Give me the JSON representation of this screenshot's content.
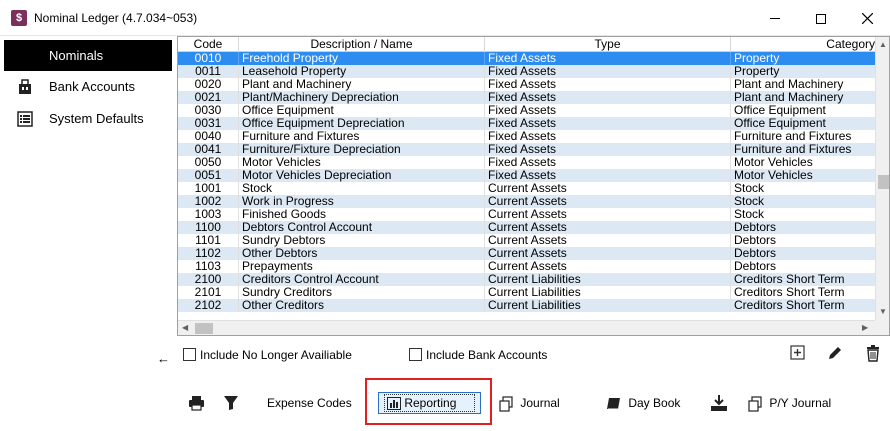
{
  "window": {
    "title": "Nominal Ledger (4.7.034~053)",
    "app_icon_glyph": "$"
  },
  "sidebar": {
    "items": [
      {
        "label": "Nominals",
        "icon": "list-icon",
        "active": true
      },
      {
        "label": "Bank Accounts",
        "icon": "bank-icon",
        "active": false
      },
      {
        "label": "System Defaults",
        "icon": "defaults-list-icon",
        "active": false
      }
    ]
  },
  "grid": {
    "columns": [
      "Code",
      "Description / Name",
      "Type",
      "Category"
    ],
    "rows": [
      {
        "code": "0010",
        "desc": "Freehold Property",
        "type": "Fixed Assets",
        "cat": "Property",
        "selected": true
      },
      {
        "code": "0011",
        "desc": "Leasehold Property",
        "type": "Fixed Assets",
        "cat": "Property"
      },
      {
        "code": "0020",
        "desc": "Plant and Machinery",
        "type": "Fixed Assets",
        "cat": "Plant and Machinery"
      },
      {
        "code": "0021",
        "desc": "Plant/Machinery Depreciation",
        "type": "Fixed Assets",
        "cat": "Plant and Machinery"
      },
      {
        "code": "0030",
        "desc": "Office Equipment",
        "type": "Fixed Assets",
        "cat": "Office Equipment"
      },
      {
        "code": "0031",
        "desc": "Office Equipment Depreciation",
        "type": "Fixed Assets",
        "cat": "Office Equipment"
      },
      {
        "code": "0040",
        "desc": "Furniture and Fixtures",
        "type": "Fixed Assets",
        "cat": "Furniture and Fixtures"
      },
      {
        "code": "0041",
        "desc": "Furniture/Fixture Depreciation",
        "type": "Fixed Assets",
        "cat": "Furniture and Fixtures"
      },
      {
        "code": "0050",
        "desc": "Motor Vehicles",
        "type": "Fixed Assets",
        "cat": "Motor Vehicles"
      },
      {
        "code": "0051",
        "desc": "Motor Vehicles Depreciation",
        "type": "Fixed Assets",
        "cat": "Motor Vehicles"
      },
      {
        "code": "1001",
        "desc": "Stock",
        "type": "Current Assets",
        "cat": "Stock"
      },
      {
        "code": "1002",
        "desc": "Work in Progress",
        "type": "Current Assets",
        "cat": "Stock"
      },
      {
        "code": "1003",
        "desc": "Finished Goods",
        "type": "Current Assets",
        "cat": "Stock"
      },
      {
        "code": "1100",
        "desc": "Debtors Control Account",
        "type": "Current Assets",
        "cat": "Debtors"
      },
      {
        "code": "1101",
        "desc": "Sundry Debtors",
        "type": "Current Assets",
        "cat": "Debtors"
      },
      {
        "code": "1102",
        "desc": "Other Debtors",
        "type": "Current Assets",
        "cat": "Debtors"
      },
      {
        "code": "1103",
        "desc": "Prepayments",
        "type": "Current Assets",
        "cat": "Debtors"
      },
      {
        "code": "2100",
        "desc": "Creditors Control Account",
        "type": "Current Liabilities",
        "cat": "Creditors Short Term"
      },
      {
        "code": "2101",
        "desc": "Sundry Creditors",
        "type": "Current Liabilities",
        "cat": "Creditors Short Term"
      },
      {
        "code": "2102",
        "desc": "Other Creditors",
        "type": "Current Liabilities",
        "cat": "Creditors Short Term"
      }
    ]
  },
  "options": {
    "include_no_longer_available": "Include No Longer Availiable",
    "include_bank_accounts": "Include Bank Accounts"
  },
  "toolbar": {
    "expense_codes": "Expense Codes",
    "reporting": "Reporting",
    "journal": "Journal",
    "day_book": "Day Book",
    "py_journal": "P/Y Journal"
  },
  "colors": {
    "selected_row": "#2d8cf0",
    "alt_row": "#dce8f3",
    "highlight_border": "#e02020",
    "app_icon": "#7b2f5c"
  }
}
